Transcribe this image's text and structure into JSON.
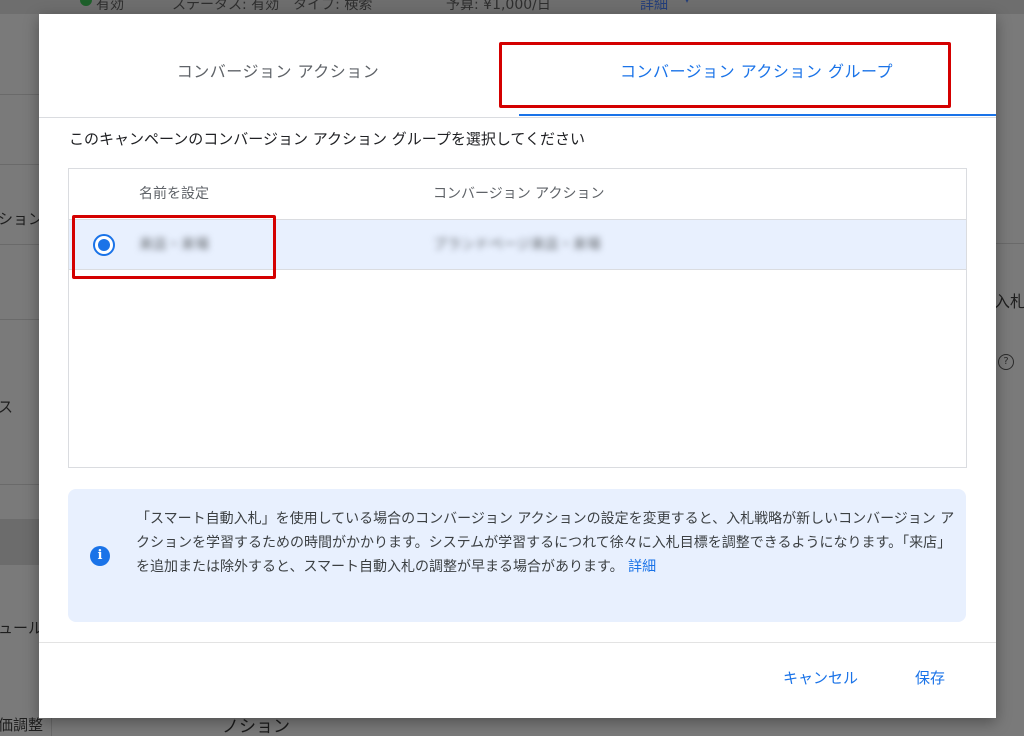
{
  "background": {
    "top_bar": {
      "status": "有効",
      "status_type": "ステータス: 有効　タイプ: 検索",
      "budget": "予算: ¥1,000/日",
      "details_link": "詳細"
    },
    "left_nav_fragments": [
      "ション",
      "ス",
      "ュール",
      "価調整"
    ],
    "right_fragment": "入札",
    "bottom_fragment": "ノション"
  },
  "dialog": {
    "tabs": [
      {
        "label": "コンバージョン アクション"
      },
      {
        "label": "コンバージョン アクション グループ",
        "selected": true
      }
    ],
    "prompt": "このキャンペーンのコンバージョン アクション グループを選択してください",
    "table": {
      "columns": [
        "名前を設定",
        "コンバージョン アクション"
      ],
      "rows": [
        {
          "selected": true,
          "name": "来店・来場",
          "conversion_action": "ブランドページ来店・来場"
        }
      ]
    },
    "info": {
      "icon": "info-icon",
      "text": "「スマート自動入札」を使用している場合のコンバージョン アクションの設定を変更すると、入札戦略が新しいコンバージョン アクションを学習するための時間がかかります。システムが学習するにつれて徐々に入札目標を調整できるようになります。「来店」を追加または除外すると、スマート自動入札の調整が早まる場合があります。",
      "link": "詳細"
    },
    "buttons": {
      "cancel": "キャンセル",
      "save": "保存"
    }
  },
  "colors": {
    "accent": "#1a73e8",
    "highlight_box": "#d40000",
    "selected_row": "#e8f0fe",
    "overlay": "#7a7a7a"
  }
}
